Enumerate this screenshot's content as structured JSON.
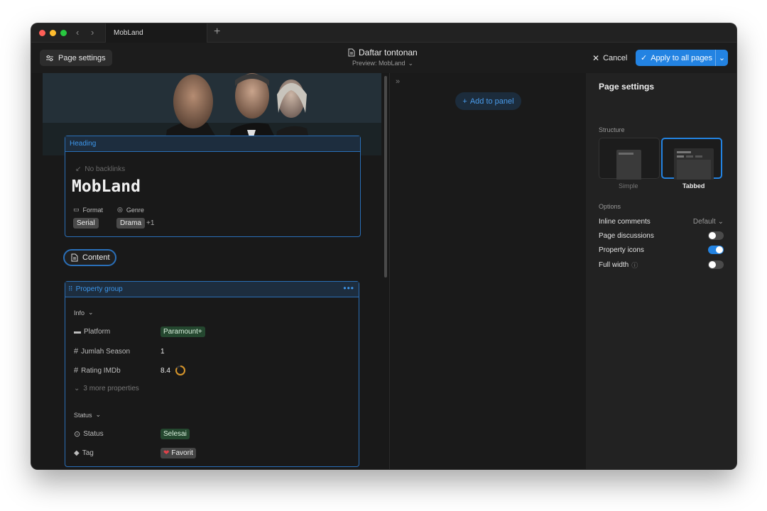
{
  "titlebar": {
    "tab_title": "MobLand"
  },
  "toolbar": {
    "page_settings_label": "Page settings",
    "doc_title": "Daftar tontonan",
    "preview_label": "Preview: MobLand",
    "cancel_label": "Cancel",
    "apply_label": "Apply to all pages"
  },
  "heading_block": {
    "label": "Heading",
    "backlinks": "No backlinks",
    "title": "MobLand",
    "format_label": "Format",
    "genre_label": "Genre",
    "format_value": "Serial",
    "genre_value": "Drama",
    "genre_more": "+1"
  },
  "content_button": "Content",
  "property_group": {
    "label": "Property group",
    "info_section": "Info",
    "status_section": "Status",
    "properties": [
      {
        "key": "Platform",
        "value": "Paramount+"
      },
      {
        "key": "Jumlah Season",
        "value": "1"
      },
      {
        "key": "Rating IMDb",
        "value": "8.4",
        "ring_fraction": 0.84
      },
      {
        "key": "Status",
        "value": "Selesai"
      },
      {
        "key": "Tag",
        "value": "Favorit"
      }
    ],
    "more_properties": "3 more properties"
  },
  "middle": {
    "add_to_panel": "Add to panel"
  },
  "sidebar": {
    "title": "Page settings",
    "structure_label": "Structure",
    "structure_simple": "Simple",
    "structure_tabbed": "Tabbed",
    "selected_structure": "Tabbed",
    "options_label": "Options",
    "options": [
      {
        "label": "Inline comments",
        "value": "Default"
      },
      {
        "label": "Page discussions",
        "toggle": false
      },
      {
        "label": "Property icons",
        "toggle": true
      },
      {
        "label": "Full width",
        "toggle": false
      }
    ]
  },
  "colors": {
    "accent": "#2383e2",
    "green_tag": "#24472f",
    "rating_ring": "#d8962a"
  }
}
